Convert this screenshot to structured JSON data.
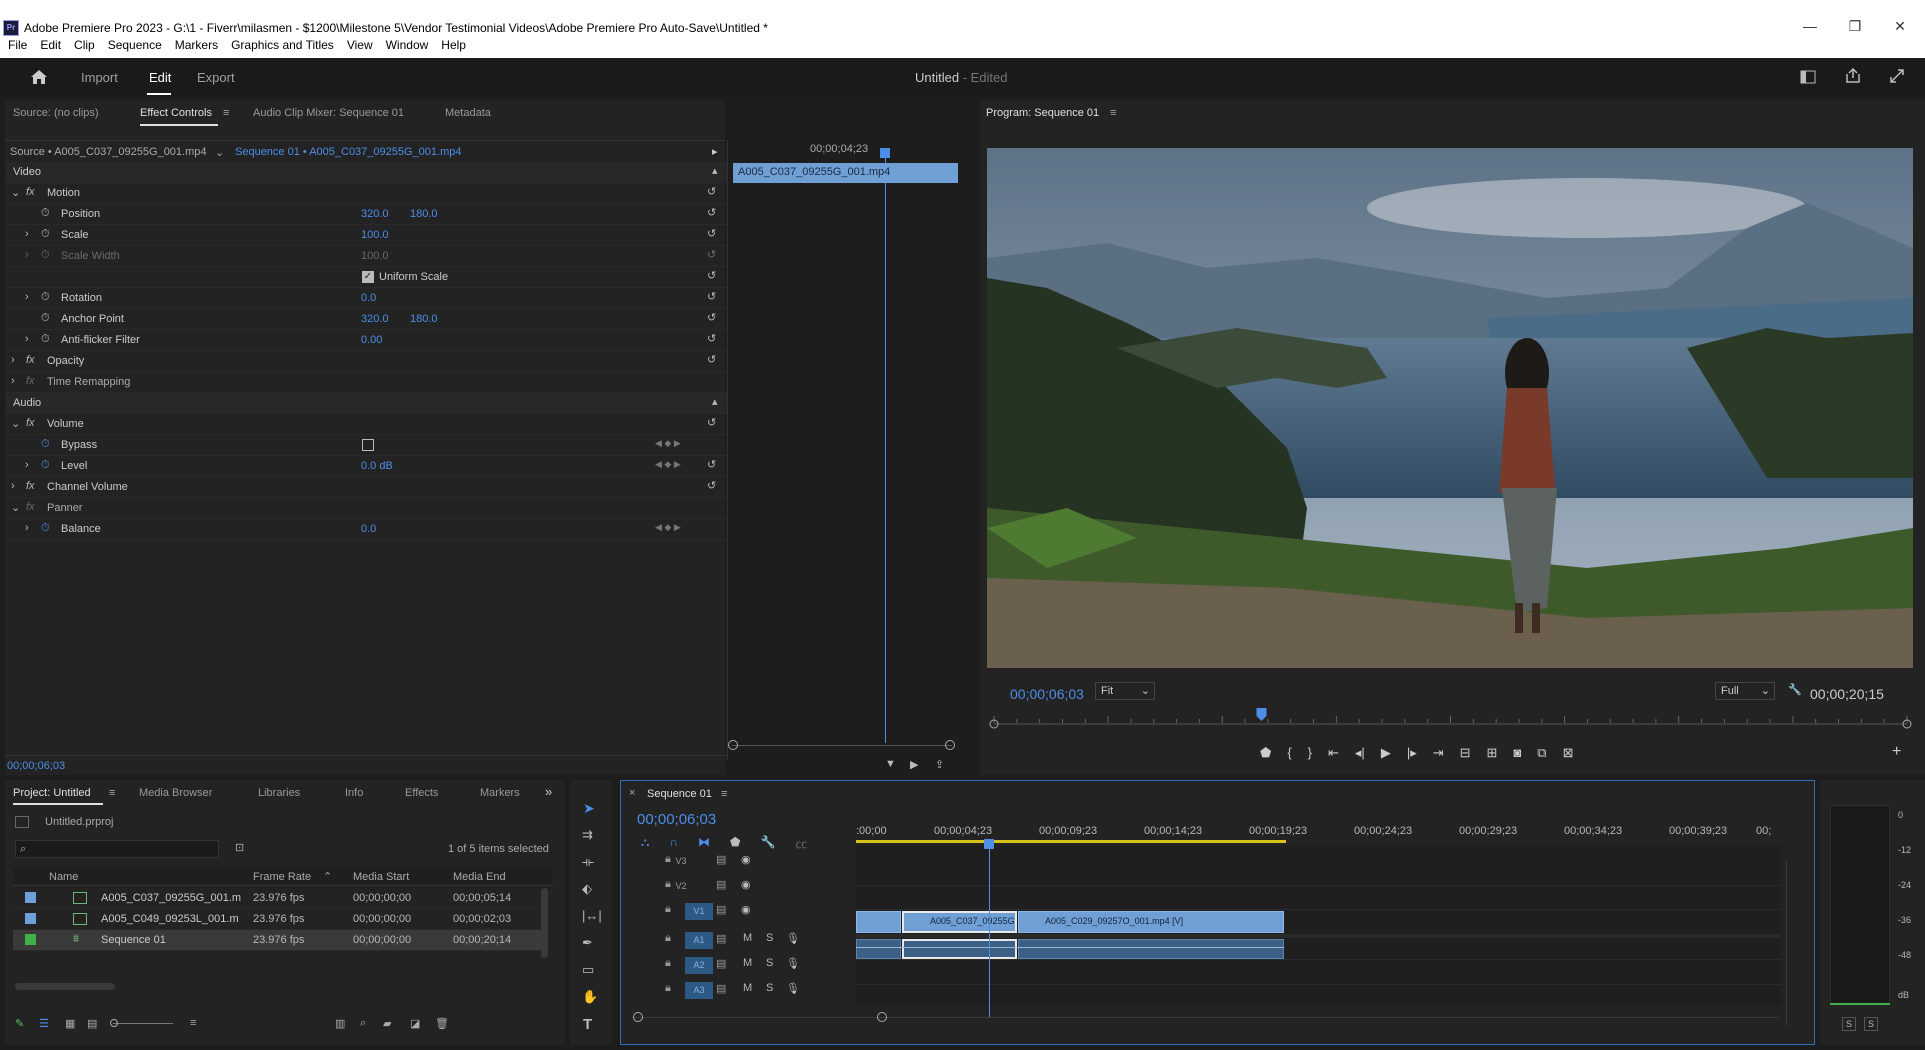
{
  "window": {
    "title": "Adobe Premiere Pro 2023 - G:\\1 - Fiverr\\milasmen - $1200\\Milestone 5\\Vendor Testimonial Videos\\Adobe Premiere Pro Auto-Save\\Untitled *",
    "app_icon": "Pr",
    "minimize": "—",
    "restore": "❐",
    "close": "✕"
  },
  "menu": [
    "File",
    "Edit",
    "Clip",
    "Sequence",
    "Markers",
    "Graphics and Titles",
    "View",
    "Window",
    "Help"
  ],
  "header": {
    "tabs": [
      "Import",
      "Edit",
      "Export"
    ],
    "active_tab": "Edit",
    "project": "Untitled",
    "edited": " - Edited"
  },
  "source_panel": {
    "tabs": [
      "Source: (no clips)",
      "Effect Controls",
      "Audio Clip Mixer: Sequence 01",
      "Metadata"
    ],
    "active": "Effect Controls"
  },
  "effect_controls": {
    "source_label": "Source • A005_C037_09255G_001.mp4",
    "sequence_label": "Sequence 01 • A005_C037_09255G_001.mp4",
    "timecode_mini": "00;00;04;23",
    "clip_name": "A005_C037_09255G_001.mp4",
    "sections": {
      "video": "Video",
      "audio": "Audio"
    },
    "effects": {
      "motion": "Motion",
      "position": "Position",
      "position_x": "320.0",
      "position_y": "180.0",
      "scale": "Scale",
      "scale_val": "100.0",
      "scale_width": "Scale Width",
      "scale_width_val": "100.0",
      "uniform_scale": "Uniform Scale",
      "rotation": "Rotation",
      "rotation_val": "0.0",
      "anchor": "Anchor Point",
      "anchor_x": "320.0",
      "anchor_y": "180.0",
      "antiflicker": "Anti-flicker Filter",
      "antiflicker_val": "0.00",
      "opacity": "Opacity",
      "time_remap": "Time Remapping",
      "volume": "Volume",
      "bypass": "Bypass",
      "level": "Level",
      "level_val": "0.0 dB",
      "channel_volume": "Channel Volume",
      "panner": "Panner",
      "balance": "Balance",
      "balance_val": "0.0"
    },
    "bottom_timecode": "00;00;06;03"
  },
  "program": {
    "title": "Program: Sequence 01",
    "timecode": "00;00;06;03",
    "fit": "Fit",
    "quality": "Full",
    "duration": "00;00;20;15",
    "playhead_fraction": 0.293
  },
  "project_panel": {
    "tabs": [
      "Project: Untitled",
      "Media Browser",
      "Libraries",
      "Info",
      "Effects",
      "Markers"
    ],
    "file": "Untitled.prproj",
    "selected": "1 of 5 items selected",
    "columns": [
      "Name",
      "Frame Rate",
      "Media Start",
      "Media End"
    ],
    "items": [
      {
        "name": "A005_C037_09255G_001.m",
        "fps": "23.976 fps",
        "start": "00;00;00;00",
        "end": "00;00;05;14",
        "color": "#6fa0d8"
      },
      {
        "name": "A005_C049_09253L_001.m",
        "fps": "23.976 fps",
        "start": "00;00;00;00",
        "end": "00;00;02;03",
        "color": "#6fa0d8"
      },
      {
        "name": "Sequence 01",
        "fps": "23.976 fps",
        "start": "00;00;00;00",
        "end": "00;00;20;14",
        "color": "#3fb04a"
      }
    ]
  },
  "timeline": {
    "tab": "Sequence 01",
    "timecode": "00;00;06;03",
    "ruler": [
      ":00;00",
      "00;00;04;23",
      "00;00;09;23",
      "00;00;14;23",
      "00;00;19;23",
      "00;00;24;23",
      "00;00;29;23",
      "00;00;34;23",
      "00;00;39;23",
      "00;"
    ],
    "video_tracks": [
      "V3",
      "V2",
      "V1"
    ],
    "audio_tracks": [
      "A1",
      "A2",
      "A3"
    ],
    "clip1": "A005_C037_09255G",
    "clip2": "A005_C029_09257O_001.mp4 [V]",
    "m": "M",
    "s": "S"
  },
  "meter": {
    "scale": [
      "0",
      "-12",
      "-24",
      "-36",
      "-48",
      "dB"
    ],
    "s1": "S",
    "s2": "S"
  },
  "colors": {
    "accent": "#4c8ee8",
    "clip": "#6f9fd5",
    "bg": "#232323"
  }
}
